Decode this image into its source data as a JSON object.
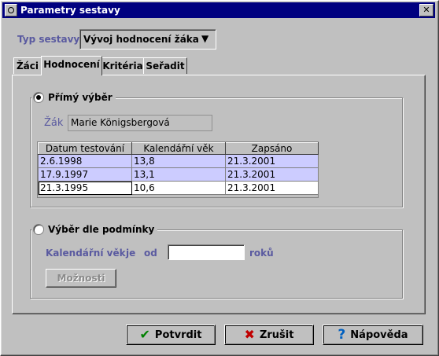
{
  "window": {
    "title": "Parametry sestavy",
    "close_label": "✕"
  },
  "report_type": {
    "label": "Typ sestavy",
    "value": "Vývoj hodnocení žáka"
  },
  "tabs": [
    {
      "label": "Žáci"
    },
    {
      "label": "Hodnocení"
    },
    {
      "label": "Kritéria"
    },
    {
      "label": "Seřadit"
    }
  ],
  "direct_selection": {
    "label": "Přímý výběr",
    "student_label": "Žák",
    "student_value": "Marie Königsbergová",
    "columns": [
      "Datum testování",
      "Kalendářní věk",
      "Zapsáno"
    ],
    "rows": [
      [
        "2.6.1998",
        "13,8",
        "21.3.2001"
      ],
      [
        "17.9.1997",
        "13,1",
        "21.3.2001"
      ],
      [
        "21.3.1995",
        "10,6",
        "21.3.2001"
      ]
    ]
  },
  "condition_selection": {
    "label": "Výběr dle podmínky",
    "field_label": "Kalendářní věk",
    "je": "je",
    "od": "od",
    "input_value": "",
    "unit": "roků",
    "options_button": "Možnosti"
  },
  "buttons": {
    "confirm": "Potvrdit",
    "cancel": "Zrušit",
    "help": "Nápověda"
  },
  "colors": {
    "title_bg": "#000080",
    "selection": "#ccccff",
    "label_purple": "#5a5aa0"
  }
}
